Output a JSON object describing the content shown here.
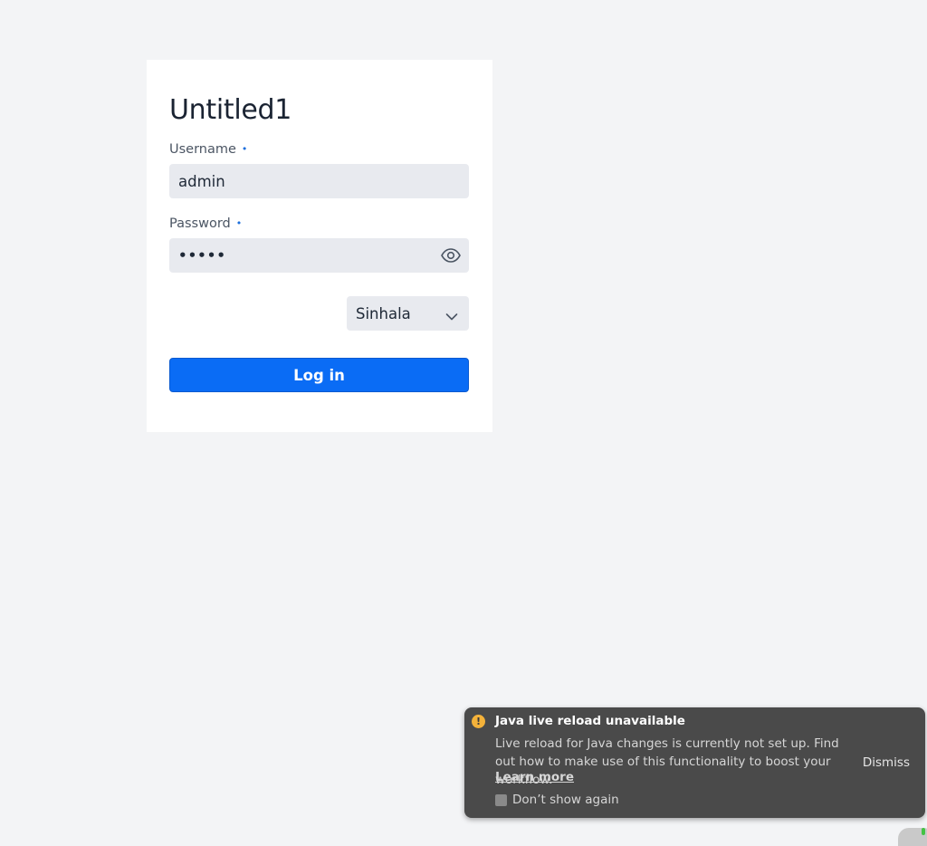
{
  "form": {
    "title": "Untitled1",
    "username_label": "Username",
    "username_value": "admin",
    "password_label": "Password",
    "password_mask": "•••••",
    "required_marker": "•",
    "language": "Sinhala",
    "login_label": "Log in"
  },
  "toast": {
    "title": "Java live reload unavailable",
    "body": "Live reload for Java changes is currently not set up. Find out how to make use of this functionality to boost your workflow.",
    "learn_more": "Learn more",
    "dont_show": "Don’t show again",
    "dismiss": "Dismiss",
    "warning_glyph": "!"
  },
  "colors": {
    "background": "#f3f4f6",
    "card": "#ffffff",
    "field": "#e8eaef",
    "primary": "#0a6cf5",
    "toast": "#4a4a4a",
    "warning": "#f4b23a"
  },
  "icons": {
    "password_toggle": "eye-icon",
    "language_dropdown": "chevron-down-icon",
    "toast_status": "warning-icon"
  }
}
